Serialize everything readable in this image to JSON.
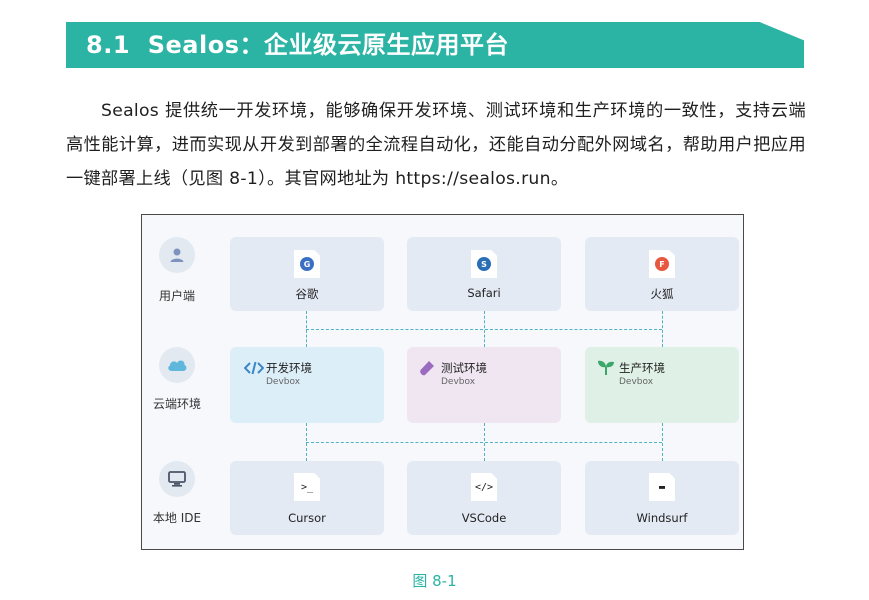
{
  "section": {
    "number": "8.1",
    "title": "Sealos：企业级云原生应用平台"
  },
  "paragraph": "Sealos 提供统一开发环境，能够确保开发环境、测试环境和生产环境的一致性，支持云端高性能计算，进而实现从开发到部署的全流程自动化，还能自动分配外网域名，帮助用户把应用一键部署上线（见图 8-1）。其官网地址为 https://sealos.run。",
  "diagram": {
    "rows": {
      "user": {
        "label": "用户端",
        "icon": "user-icon"
      },
      "cloud": {
        "label": "云端环境",
        "icon": "cloud-icon"
      },
      "ide": {
        "label": "本地 IDE",
        "icon": "monitor-icon"
      }
    },
    "browsers": [
      {
        "name": "谷歌",
        "badge": "G",
        "color": "#3b6fc4",
        "icon": "chrome-icon"
      },
      {
        "name": "Safari",
        "badge": "S",
        "color": "#2a6fb5",
        "icon": "safari-icon"
      },
      {
        "name": "火狐",
        "badge": "F",
        "color": "#e8583e",
        "icon": "firefox-icon"
      }
    ],
    "environments": [
      {
        "name": "开发环境",
        "sub": "Devbox",
        "icon": "code-icon",
        "color": "#3b86c9"
      },
      {
        "name": "测试环境",
        "sub": "Devbox",
        "icon": "flask-icon",
        "color": "#9b6bc0"
      },
      {
        "name": "生产环境",
        "sub": "Devbox",
        "icon": "sprout-icon",
        "color": "#3aa86a"
      }
    ],
    "ides": [
      {
        "name": "Cursor",
        "glyph": ">_",
        "icon": "terminal-icon"
      },
      {
        "name": "VSCode",
        "glyph": "</>",
        "icon": "code-file-icon"
      },
      {
        "name": "Windsurf",
        "glyph": "▬",
        "icon": "window-icon"
      }
    ]
  },
  "caption": "图 8-1"
}
